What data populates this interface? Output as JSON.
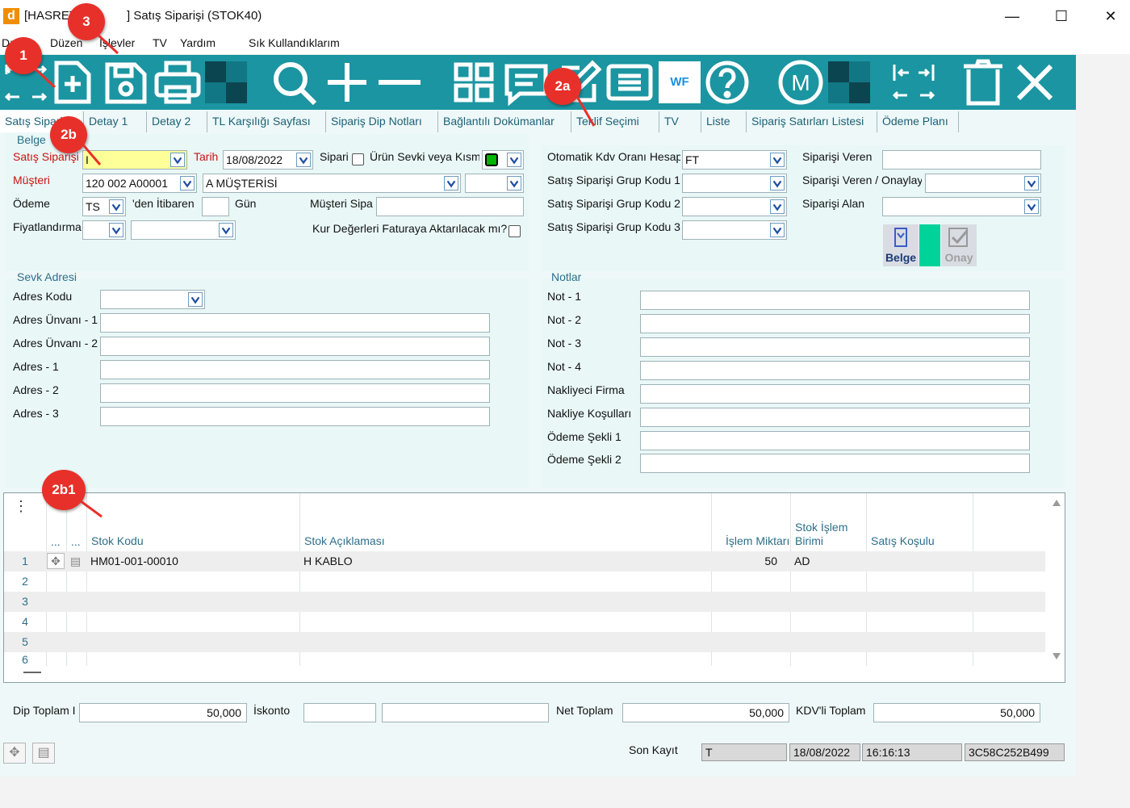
{
  "window": {
    "logo": "d",
    "title_prefix": "[HASRET",
    "title_suffix": "] Satış Siparişi (STOK40)",
    "minimize": "—",
    "maximize": "☐",
    "close": "✕"
  },
  "menu": {
    "items": [
      "Dosya",
      "Düzen",
      "İşlevler",
      "TV",
      "Yardım",
      "Sık Kullandıklarım"
    ],
    "items_shown": [
      "Dı",
      "Düzen",
      "İşlevler",
      "TV",
      "Yardım",
      "Sık Kullandıklarım"
    ]
  },
  "toolbar": {
    "wf_label": "WF",
    "m_label": "M",
    "icons": [
      "nav-arrows-icon",
      "new-document-icon",
      "save-icon",
      "print-icon",
      "magnify-icon",
      "plus-icon",
      "minus-icon",
      "grid-icon",
      "message-icon",
      "edit-icon",
      "list-icon",
      "wf-icon",
      "help-icon",
      "m-icon",
      "column-arrows-icon",
      "delete-icon",
      "close-icon"
    ]
  },
  "tabs": [
    "Satış Siparişi",
    "Detay 1",
    "Detay 2",
    "TL Karşılığı Sayfası",
    "Sipariş Dip Notları",
    "Bağlantılı Dokümanlar",
    "Teklif Seçimi",
    "TV",
    "Liste",
    "Sipariş Satırları Listesi",
    "Ödeme Planı"
  ],
  "tabs_shown": [
    "Satış Sipari",
    "Detay 1",
    "Detay 2",
    "TL Karşılığı Sayfası",
    "Sipariş Dip Notları",
    "Bağlantılı Dokümanlar",
    "Teklif Seçimi",
    "TV",
    "Liste",
    "Sipariş Satırları Listesi",
    "Ödeme Planı"
  ],
  "belge": {
    "section_title": "Belge",
    "satis_siparisi_label": "Satış Siparişi",
    "satis_siparisi_value": "I",
    "tarih_label": "Tarih",
    "tarih_value": "18/08/2022",
    "sipari_label": "Sipari",
    "urun_sevki_label": "Ürün Sevki veya Kısm",
    "musteri_label": "Müşteri",
    "musteri_code": "120 002 A00001",
    "musteri_name": "A MÜŞTERİSİ",
    "odeme_label": "Ödeme",
    "odeme_value": "TS",
    "den_itibaren_label": "'den İtibaren",
    "gun_label": "Gün",
    "musteri_sipa_label": "Müşteri Sipa",
    "fiyatlandirma_label": "Fiyatlandırma",
    "kur_label": "Kur Değerleri Faturaya Aktarılacak mı?",
    "otomatik_kdv_label": "Otomatik Kdv Oranı Hesap",
    "otomatik_kdv_value": "FT",
    "grup1_label": "Satış Siparişi Grup Kodu 1",
    "grup2_label": "Satış Siparişi Grup Kodu 2",
    "grup3_label": "Satış Siparişi Grup Kodu 3",
    "siparisi_veren_label": "Siparişi Veren",
    "siparisi_veren_onaylay_label": "Siparişi Veren / Onaylay",
    "siparisi_alan_label": "Siparişi Alan",
    "belge_button": "Belge",
    "onay_button": "Onay"
  },
  "sevk": {
    "section_title": "Sevk Adresi",
    "fields": [
      "Adres Kodu",
      "Adres Ünvanı - 1",
      "Adres Ünvanı - 2",
      "Adres - 1",
      "Adres - 2",
      "Adres - 3"
    ]
  },
  "notlar": {
    "section_title": "Notlar",
    "fields": [
      "Not - 1",
      "Not - 2",
      "Not - 3",
      "Not - 4",
      "Nakliyeci Firma",
      "Nakliye Koşulları",
      "Ödeme Şekli 1",
      "Ödeme Şekli 2"
    ]
  },
  "grid": {
    "menu_glyph": "⋮",
    "col_dots1": "...",
    "col_dots2": "...",
    "headers": {
      "stok_kodu": "Stok Kodu",
      "stok_aciklamasi": "Stok Açıklaması",
      "islem_miktari": "İşlem Miktarı",
      "stok_islem_birimi_1": "Stok İşlem",
      "stok_islem_birimi_2": "Birimi",
      "satis_kosulu": "Satış Koşulu"
    },
    "rows": [
      {
        "n": "1",
        "stok_kodu": "HM01-001-00010",
        "aciklama": "H KABLO",
        "miktar": "50",
        "birim": "AD"
      },
      {
        "n": "2",
        "stok_kodu": "",
        "aciklama": "",
        "miktar": "",
        "birim": ""
      },
      {
        "n": "3",
        "stok_kodu": "",
        "aciklama": "",
        "miktar": "",
        "birim": ""
      },
      {
        "n": "4",
        "stok_kodu": "",
        "aciklama": "",
        "miktar": "",
        "birim": ""
      },
      {
        "n": "5",
        "stok_kodu": "",
        "aciklama": "",
        "miktar": "",
        "birim": ""
      },
      {
        "n": "6",
        "stok_kodu": "",
        "aciklama": "",
        "miktar": "",
        "birim": ""
      }
    ]
  },
  "totals": {
    "dip_toplam_label": "Dip Toplam I",
    "dip_toplam_value": "50,000",
    "iskonto_label": "İskonto",
    "net_toplam_label": "Net Toplam",
    "net_toplam_value": "50,000",
    "kdvli_toplam_label": "KDV'li Toplam",
    "kdvli_toplam_value": "50,000"
  },
  "status": {
    "son_kayit_label": "Son Kayıt",
    "user": "T",
    "date": "18/08/2022",
    "time": "16:16:13",
    "id": "3C58C252B499"
  },
  "annotations": [
    "1",
    "3",
    "2a",
    "2b",
    "2b1"
  ],
  "colors": {
    "toolbar": "#1b95a1",
    "accent_green": "#00d39a",
    "badge_red": "#e8302a",
    "required_red": "#d01010"
  }
}
